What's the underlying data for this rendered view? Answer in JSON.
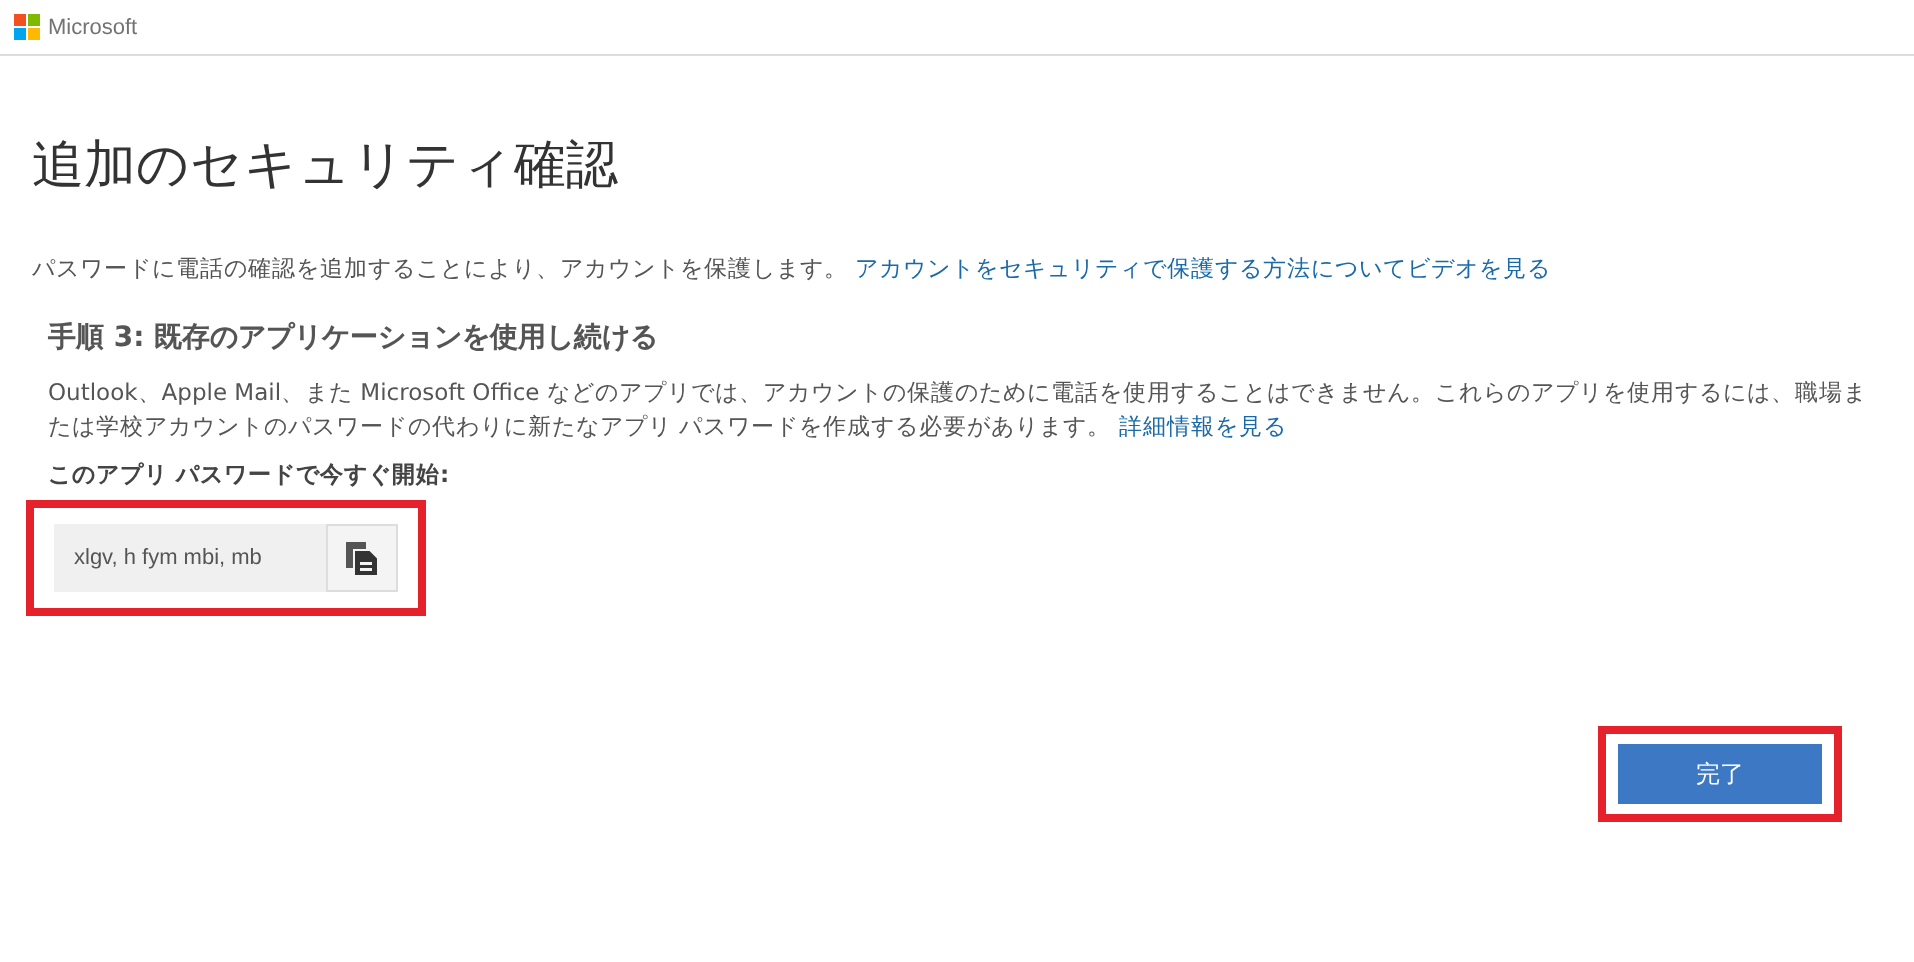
{
  "header": {
    "brand": "Microsoft"
  },
  "title": "追加のセキュリティ確認",
  "intro": {
    "text": "パスワードに電話の確認を追加することにより、アカウントを保護します。",
    "link": "アカウントをセキュリティで保護する方法についてビデオを見る"
  },
  "step": {
    "heading": "手順 3: 既存のアプリケーションを使用し続ける",
    "text": "Outlook、Apple Mail、また Microsoft Office などのアプリでは、アカウントの保護のために電話を使用することはできません。これらのアプリを使用するには、職場または学校アカウントのパスワードの代わりに新たなアプリ パスワードを作成する必要があります。",
    "link": "詳細情報を見る",
    "label": "このアプリ パスワードで今すぐ開始:",
    "password": "xlgv, h fym mbi, mb"
  },
  "done_button": "完了"
}
